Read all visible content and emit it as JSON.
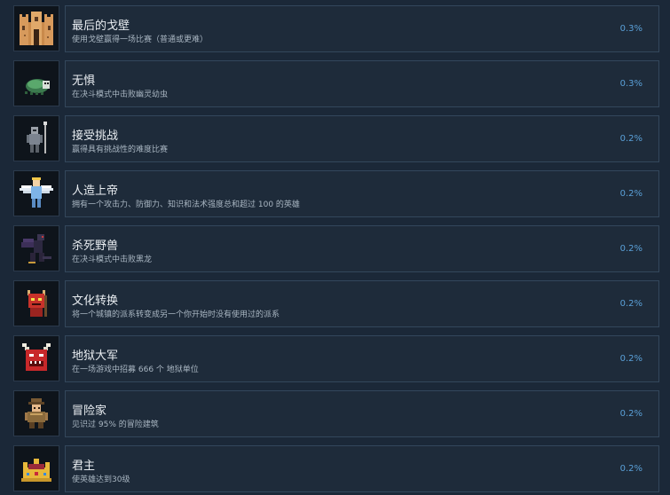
{
  "achievements": [
    {
      "title": "最后的戈壁",
      "description": "使用戈壁赢得一场比赛（普通或更难）",
      "percent": "0.3%",
      "icon": "sand-castle-icon"
    },
    {
      "title": "无惧",
      "description": "在决斗模式中击败幽灵幼虫",
      "percent": "0.3%",
      "icon": "ghost-larva-icon"
    },
    {
      "title": "接受挑战",
      "description": "赢得具有挑战性的难度比赛",
      "percent": "0.2%",
      "icon": "knight-spear-icon"
    },
    {
      "title": "人造上帝",
      "description": "拥有一个攻击力、防御力、知识和法术强度总和超过 100 的英雄",
      "percent": "0.2%",
      "icon": "winged-angel-icon"
    },
    {
      "title": "杀死野兽",
      "description": "在决斗模式中击败黑龙",
      "percent": "0.2%",
      "icon": "black-dragon-icon"
    },
    {
      "title": "文化转换",
      "description": "将一个城镇的派系转变成另一个你开始时没有使用过的派系",
      "percent": "0.2%",
      "icon": "red-demon-icon"
    },
    {
      "title": "地狱大军",
      "description": "在一场游戏中招募 666 个 地狱单位",
      "percent": "0.2%",
      "icon": "horned-devil-icon"
    },
    {
      "title": "冒险家",
      "description": "见识过 95% 的冒险建筑",
      "percent": "0.2%",
      "icon": "adventurer-icon"
    },
    {
      "title": "君主",
      "description": "使英雄达到30级",
      "percent": "0.2%",
      "icon": "crown-icon"
    }
  ]
}
